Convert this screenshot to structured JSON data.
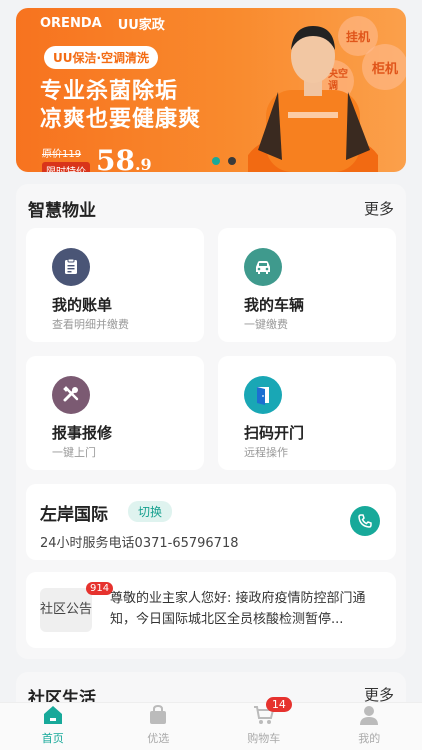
{
  "banner": {
    "brand_orenda": "ORENDA",
    "brand_uu": "UU家政",
    "tag": "UU保洁·空调清洗",
    "headline_line1": "专业杀菌除垢",
    "headline_line2": "凉爽也要健康爽",
    "original_price": "原价119",
    "special_label": "限时特价",
    "price_int": "58",
    "price_dec": ".9",
    "bubble1": "挂机",
    "bubble2": "柜机",
    "bubble3": "中央空调",
    "carousel_index": 1,
    "carousel_count": 2,
    "accent_color": "#f7731f"
  },
  "smart_property": {
    "title": "智慧物业",
    "more": "更多",
    "cards": [
      {
        "title": "我的账单",
        "subtitle": "查看明细并缴费",
        "icon": "bill-icon",
        "color": "#4a5576"
      },
      {
        "title": "我的车辆",
        "subtitle": "一键缴费",
        "icon": "car-icon",
        "color": "#3f9a8d"
      },
      {
        "title": "报事报修",
        "subtitle": "一键上门",
        "icon": "repair-tools-icon",
        "color": "#7b5a72"
      },
      {
        "title": "扫码开门",
        "subtitle": "远程操作",
        "icon": "door-icon",
        "color": "#19a7b5"
      }
    ]
  },
  "community": {
    "name": "左岸国际",
    "switch_label": "切换",
    "hotline": "24小时服务电话0371-65796718"
  },
  "notice": {
    "tag": "社区公告",
    "badge": "914",
    "text": "尊敬的业主家人您好: 接政府疫情防控部门通知，今日国际城北区全员核酸检测暂停..."
  },
  "community_life": {
    "title": "社区生活",
    "more": "更多"
  },
  "tabbar": {
    "items": [
      {
        "label": "首页",
        "icon": "home-icon",
        "active": true
      },
      {
        "label": "优选",
        "icon": "shopping-bag-icon"
      },
      {
        "label": "购物车",
        "icon": "cart-icon",
        "badge": "14"
      },
      {
        "label": "我的",
        "icon": "user-icon"
      }
    ],
    "active_color": "#17a99a"
  }
}
